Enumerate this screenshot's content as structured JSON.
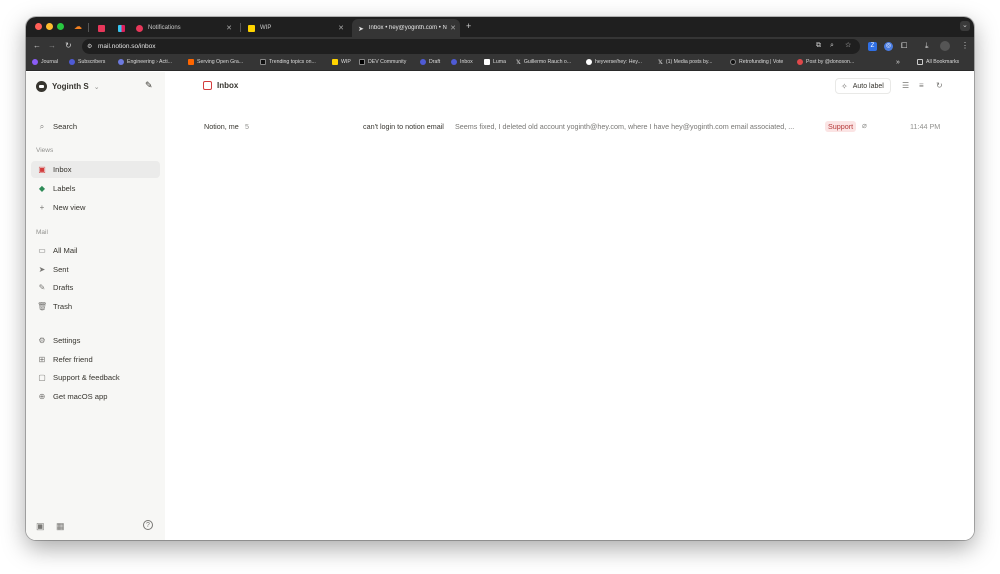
{
  "browser": {
    "tabs": [
      {
        "label": ""
      },
      {
        "label": ""
      },
      {
        "label": "Notifications"
      },
      {
        "label": "WIP"
      },
      {
        "label": "Inbox • hey@yoginth.com • N"
      }
    ],
    "url": "mail.notion.so/inbox",
    "bookmarks": [
      "Journal",
      "Subscribers",
      "Engineering › Acti...",
      "Serving Open Gra...",
      "Trending topics on...",
      "WIP",
      "DEV Community",
      "Draft",
      "Inbox",
      "Luma",
      "Guillermo Rauch o...",
      "heyverse/hey: Hey...",
      "(1) Media posts by...",
      "Retrofunding | Vote",
      "Post by @donoson...",
      "»",
      "All Bookmarks"
    ]
  },
  "sidebar": {
    "user_name": "Yoginth S",
    "search": "Search",
    "views_label": "Views",
    "views": [
      {
        "label": "Inbox",
        "icon": "inbox-icon"
      },
      {
        "label": "Labels",
        "icon": "tag-icon"
      },
      {
        "label": "New view",
        "icon": "plus-icon"
      }
    ],
    "mail_label": "Mail",
    "mail": [
      {
        "label": "All Mail",
        "icon": "all-mail-icon"
      },
      {
        "label": "Sent",
        "icon": "send-icon"
      },
      {
        "label": "Drafts",
        "icon": "drafts-icon"
      },
      {
        "label": "Trash",
        "icon": "trash-icon"
      }
    ],
    "footer_nav": [
      {
        "label": "Settings",
        "icon": "gear-icon"
      },
      {
        "label": "Refer friend",
        "icon": "gift-icon"
      },
      {
        "label": "Support & feedback",
        "icon": "chat-icon"
      },
      {
        "label": "Get macOS app",
        "icon": "download-icon"
      }
    ]
  },
  "main": {
    "title": "Inbox",
    "auto_label": "Auto label",
    "threads": [
      {
        "sender": "Notion, me",
        "count": "5",
        "subject": "can't login to notion email",
        "snippet": "Seems fixed, I deleted old account yoginth@hey.com, where I have hey@yoginth.com email associated, ...",
        "label": "Support",
        "time": "11:44 PM"
      }
    ]
  },
  "colors": {
    "accent": "#d33c3c",
    "sidebar_bg": "#f7f7f5",
    "label_bg": "#fbe4e4"
  }
}
